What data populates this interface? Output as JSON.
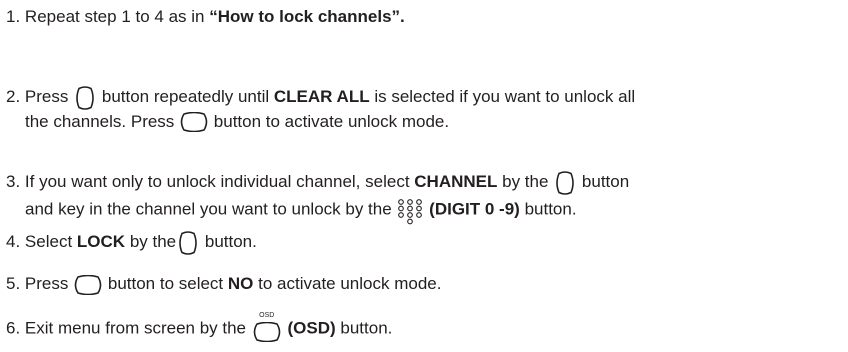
{
  "steps": [
    {
      "num": "1.",
      "t1": "Repeat step 1 to 4 as in ",
      "b1": "“How to lock channels”."
    },
    {
      "num": "2.",
      "t1": "Press",
      "t2": "button repeatedly until",
      "b1": "CLEAR ALL",
      "t3": "is selected if you want to unlock all",
      "t4": "the channels. Press",
      "t5": "button to activate unlock mode.",
      "icons": [
        "up-down-button-icon",
        "ok-button-icon"
      ]
    },
    {
      "num": "3.",
      "t1": "If you want only to unlock individual channel, select",
      "b1": "CHANNEL",
      "t2": "by the",
      "t3": "button",
      "t4": "and key in the channel you want to unlock by the",
      "b2": "(DIGIT 0 -9)",
      "t5": "button.",
      "icons": [
        "up-down-button-icon",
        "digit-keypad-icon"
      ]
    },
    {
      "num": "4.",
      "t1": "Select",
      "b1": "LOCK",
      "t2": "by the",
      "t3": "button.",
      "icons": [
        "up-down-button-icon"
      ]
    },
    {
      "num": "5.",
      "t1": "Press",
      "t2": "button to select",
      "b1": "NO",
      "t3": "to activate unlock mode.",
      "icons": [
        "ok-button-icon"
      ]
    },
    {
      "num": "6.",
      "t1": "Exit menu from screen by the",
      "icon_label": "OSD",
      "b1": "(OSD)",
      "t2": "button.",
      "icons": [
        "osd-button-icon"
      ]
    }
  ]
}
